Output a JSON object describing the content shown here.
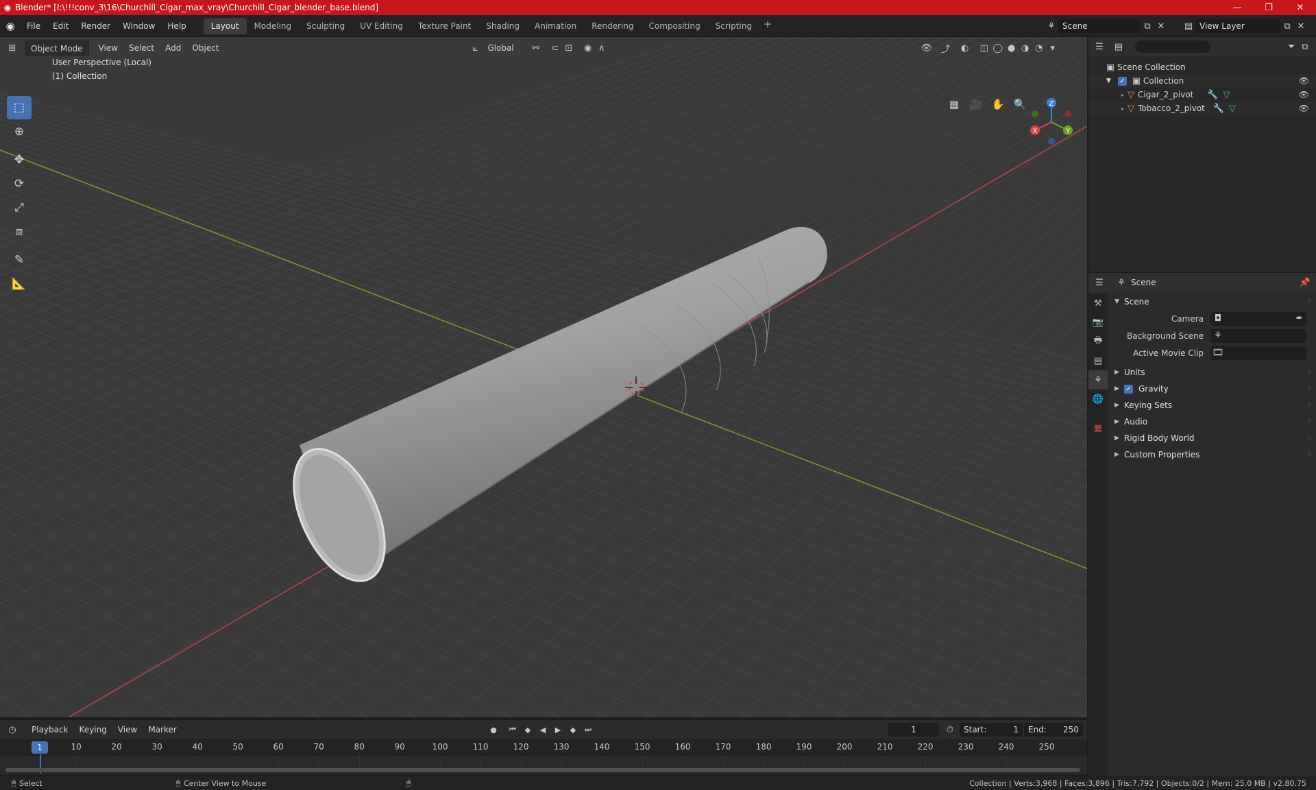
{
  "window": {
    "title": "Blender* [I:\\!!!conv_3\\16\\Churchill_Cigar_max_vray\\Churchill_Cigar_blender_base.blend]",
    "minimize": "—",
    "maximize": "❐",
    "close": "✕"
  },
  "menu": {
    "file": "File",
    "edit": "Edit",
    "render": "Render",
    "window": "Window",
    "help": "Help"
  },
  "workspaces": [
    "Layout",
    "Modeling",
    "Sculpting",
    "UV Editing",
    "Texture Paint",
    "Shading",
    "Animation",
    "Rendering",
    "Compositing",
    "Scripting"
  ],
  "active_workspace": "Layout",
  "scene_selector": {
    "value": "Scene"
  },
  "view_layer_selector": {
    "value": "View Layer"
  },
  "viewport": {
    "mode": "Object Mode",
    "menus": {
      "view": "View",
      "select": "Select",
      "add": "Add",
      "object": "Object"
    },
    "transform_orientation": "Global",
    "overlay_line1": "User Perspective (Local)",
    "overlay_line2": "(1) Collection"
  },
  "gizmo": {
    "z": "Z",
    "y": "Y",
    "x": "X"
  },
  "outliner": {
    "search_placeholder": "",
    "scene_collection": "Scene Collection",
    "collection": "Collection",
    "objects": [
      "Cigar_2_pivot",
      "Tobacco_2_pivot"
    ]
  },
  "properties": {
    "context": "Scene",
    "panel_title": "Scene",
    "camera_label": "Camera",
    "camera_value": "",
    "background_scene_label": "Background Scene",
    "background_scene_value": "",
    "active_movie_clip_label": "Active Movie Clip",
    "active_movie_clip_value": "",
    "collapsed_panels": {
      "units": "Units",
      "gravity": "Gravity",
      "keying_sets": "Keying Sets",
      "audio": "Audio",
      "rigid_body_world": "Rigid Body World",
      "custom_properties": "Custom Properties"
    },
    "gravity_enabled": true
  },
  "timeline": {
    "menus": {
      "playback": "Playback",
      "keying": "Keying",
      "view": "View",
      "marker": "Marker"
    },
    "current_frame": "1",
    "start_label": "Start:",
    "start_value": "1",
    "end_label": "End:",
    "end_value": "250",
    "ruler_current": "1",
    "ruler_ticks": [
      "10",
      "20",
      "30",
      "40",
      "50",
      "60",
      "70",
      "80",
      "90",
      "100",
      "110",
      "120",
      "130",
      "140",
      "150",
      "160",
      "170",
      "180",
      "190",
      "200",
      "210",
      "220",
      "230",
      "240",
      "250"
    ]
  },
  "statusbar": {
    "left_hint": "Select",
    "middle_hint": "Center View to Mouse",
    "stats": "Collection | Verts:3,968 | Faces:3,896 | Tris:7,792 | Objects:0/2 | Mem: 25.0 MB | v2.80.75"
  },
  "colors": {
    "title_bar": "#c8161d",
    "accent": "#4772b3",
    "viewport_bg": "#3a3a3a",
    "axis_x": "#c8464c",
    "axis_y": "#86a52a",
    "gizmo_x": "#e3424d",
    "gizmo_y": "#6ba51d",
    "gizmo_z": "#3e7fd7"
  }
}
